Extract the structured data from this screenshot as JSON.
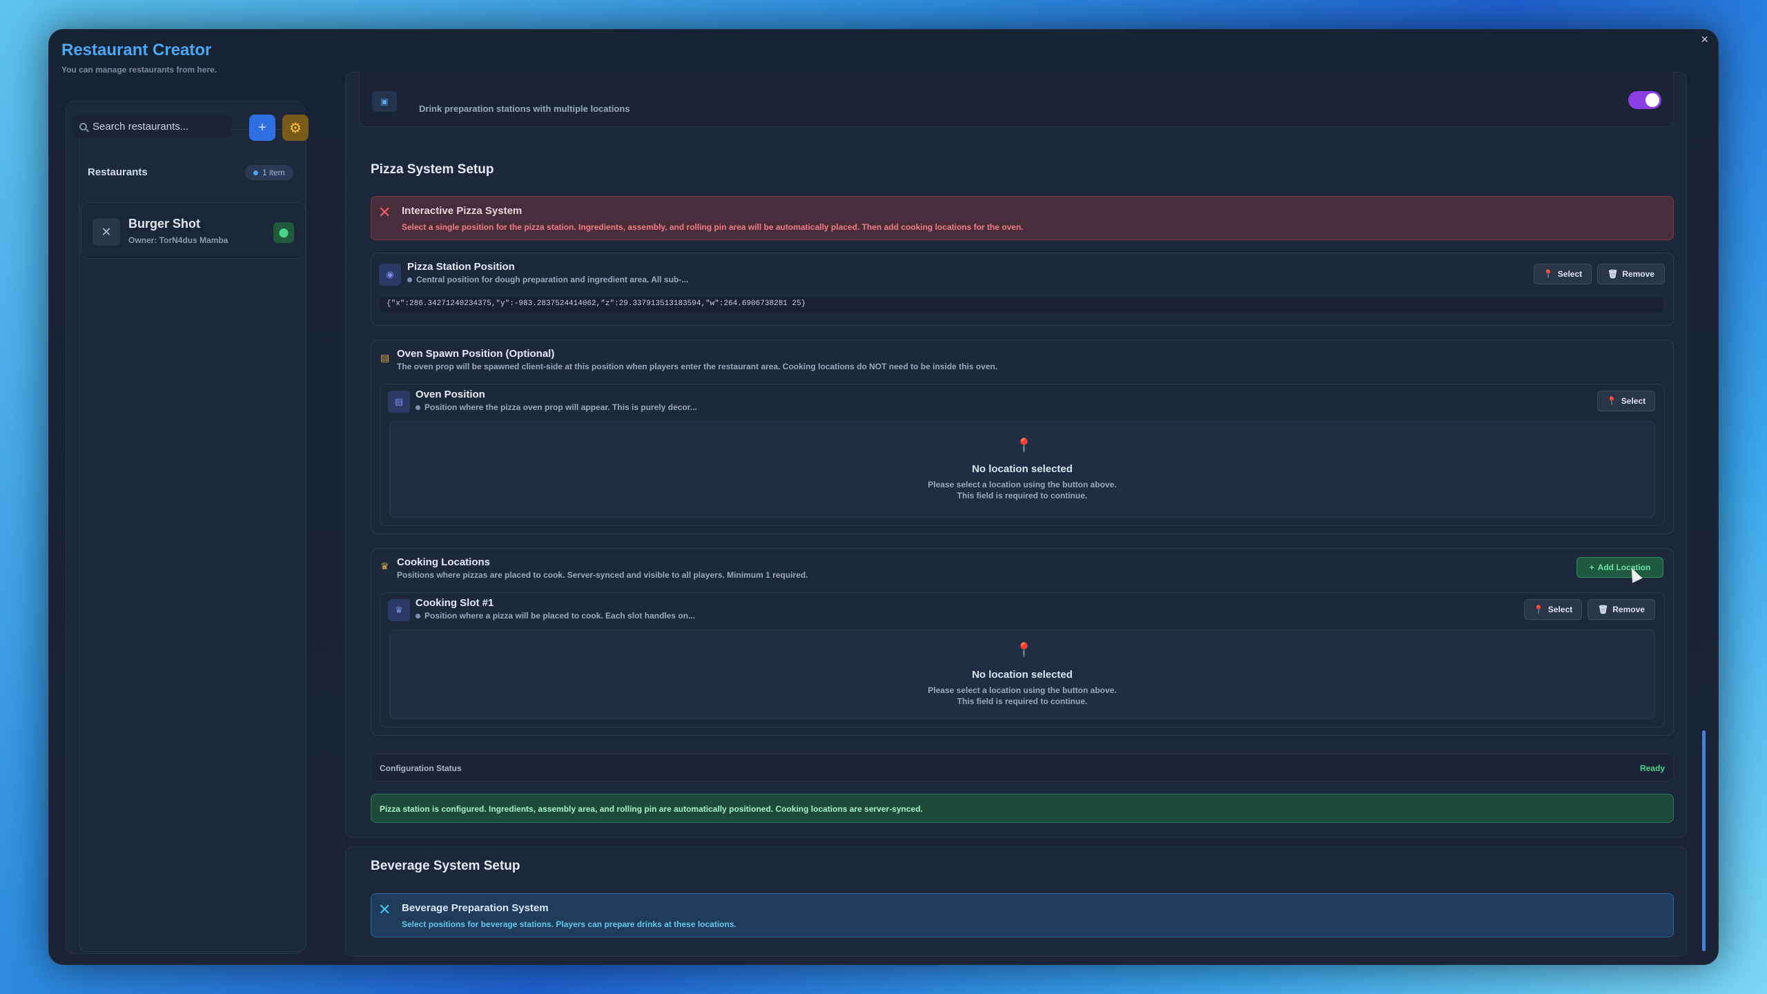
{
  "window": {
    "title": "Restaurant Creator",
    "subtitle": "You can manage restaurants from here.",
    "close_glyph": "×"
  },
  "sidebar": {
    "search_placeholder": "Search restaurants...",
    "add_glyph": "+",
    "settings_glyph": "⚙",
    "list_label": "Restaurants",
    "item_count": "1 item",
    "items": [
      {
        "name": "Burger Shot",
        "owner": "Owner: TorN4dus Mamba",
        "icon": "utensils-icon"
      }
    ]
  },
  "top_row": {
    "description": "Drink preparation stations with multiple locations"
  },
  "pizza": {
    "section_title": "Pizza System Setup",
    "alert_title": "Interactive Pizza System",
    "alert_desc": "Select a single position for the pizza station. Ingredients, assembly, and rolling pin area will be automatically placed. Then add cooking locations for the oven.",
    "station": {
      "title": "Pizza Station Position",
      "desc": "Central position for dough preparation and ingredient area. All sub-...",
      "select_label": "Select",
      "remove_label": "Remove",
      "coords": "{\"x\":286.34271240234375,\"y\":-983.2837524414062,\"z\":29.337913513183594,\"w\":264.6906738281 25}"
    },
    "oven": {
      "section_title": "Oven Spawn Position (Optional)",
      "section_desc": "The oven prop will be spawned client-side at this position when players enter the restaurant area. Cooking locations do NOT need to be inside this oven.",
      "title": "Oven Position",
      "desc": "Position where the pizza oven prop will appear. This is purely decor...",
      "select_label": "Select",
      "empty_title": "No location selected",
      "empty_line1": "Please select a location using the button above.",
      "empty_line2": "This field is required to continue."
    },
    "cooking": {
      "section_title": "Cooking Locations",
      "section_desc": "Positions where pizzas are placed to cook. Server-synced and visible to all players. Minimum 1 required.",
      "add_label": "Add Location",
      "slot_title": "Cooking Slot #1",
      "slot_desc": "Position where a pizza will be placed to cook. Each slot handles on...",
      "select_label": "Select",
      "remove_label": "Remove",
      "empty_title": "No location selected",
      "empty_line1": "Please select a location using the button above.",
      "empty_line2": "This field is required to continue."
    },
    "config_status_label": "Configuration Status",
    "config_status_value": "Ready",
    "success_message": "Pizza station is configured. Ingredients, assembly area, and rolling pin are automatically positioned. Cooking locations are server-synced."
  },
  "beverage": {
    "section_title": "Beverage System Setup",
    "alert_title": "Beverage Preparation System",
    "alert_desc": "Select positions for beverage stations. Players can prepare drinks at these locations."
  },
  "colors": {
    "accent_blue": "#4aa8f5",
    "danger": "#f05d6a",
    "success": "#4cd58a",
    "toggle_purple": "#8a3fe3"
  }
}
